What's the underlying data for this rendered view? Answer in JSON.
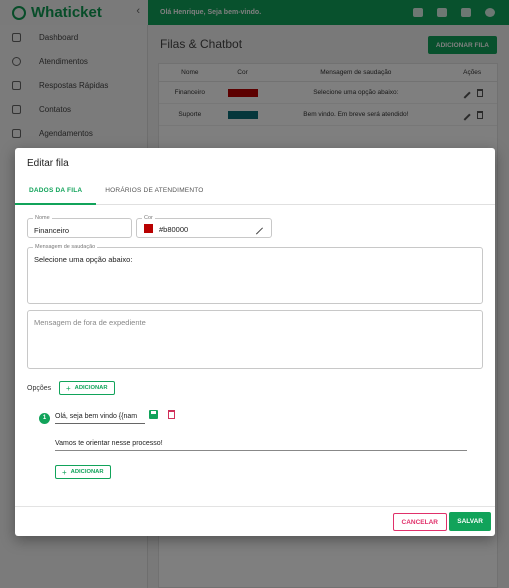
{
  "app": {
    "brand": "Whaticket",
    "greeting": "Olá Henrique, Seja bem-vindo."
  },
  "sidebar": {
    "items": [
      {
        "label": "Dashboard"
      },
      {
        "label": "Atendimentos"
      },
      {
        "label": "Respostas Rápidas"
      },
      {
        "label": "Contatos"
      },
      {
        "label": "Agendamentos"
      }
    ]
  },
  "page": {
    "title": "Filas & Chatbot",
    "add_button": "ADICIONAR FILA"
  },
  "table": {
    "headers": [
      "Nome",
      "Cor",
      "Mensagem de saudação",
      "Ações"
    ],
    "rows": [
      {
        "name": "Financeiro",
        "color": "#b80000",
        "message": "Selecione uma opção abaixo:"
      },
      {
        "name": "Suporte",
        "color": "#0a6f79",
        "message": "Bem vindo. Em breve será atendido!"
      }
    ]
  },
  "dialog": {
    "title": "Editar fila",
    "tabs": [
      "DADOS DA FILA",
      "HORÁRIOS DE ATENDIMENTO"
    ],
    "name_label": "Nome",
    "name_value": "Financeiro",
    "color_label": "Cor",
    "color_value": "#b80000",
    "greeting_label": "Mensagem de saudação",
    "greeting_value": "Selecione uma opção abaixo:",
    "offhours_placeholder": "Mensagem de fora de expediente",
    "options_label": "Opções",
    "add_label": "ADICIONAR",
    "option_number": "1",
    "option_title": "Olá, seja bem vindo {{nam",
    "option_message": "Vamos te orientar nesse processo!",
    "cancel": "CANCELAR",
    "save": "SALVAR"
  }
}
